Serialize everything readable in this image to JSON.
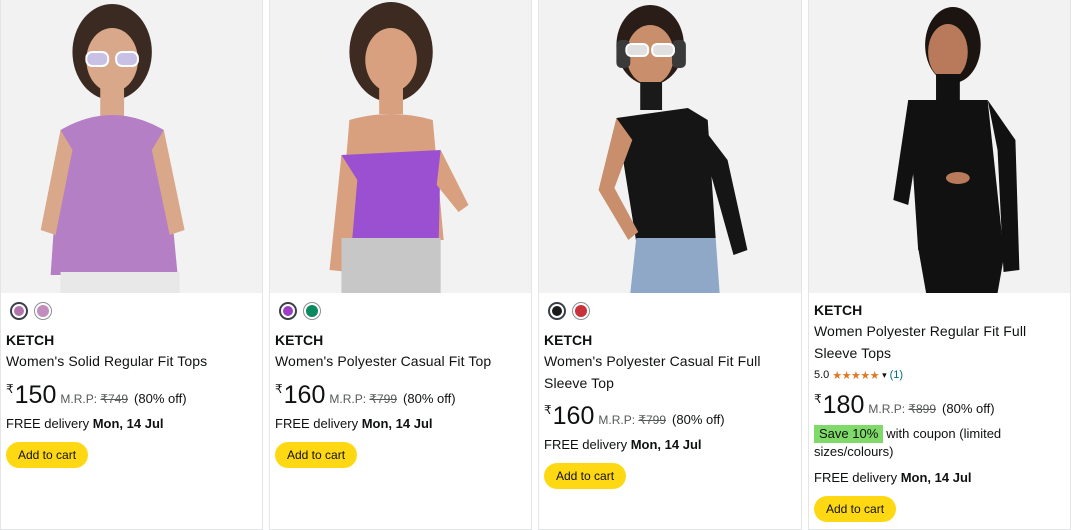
{
  "products": [
    {
      "swatches": [
        {
          "color": "#b274ae",
          "selected": true
        },
        {
          "color": "#c28cbf",
          "selected": false
        }
      ],
      "brand": "KETCH",
      "title": "Women's Solid Regular Fit Tops",
      "currency": "₹",
      "price": "150",
      "mrp_label": "M.R.P:",
      "mrp": "₹749",
      "discount": "(80% off)",
      "delivery_prefix": "FREE delivery",
      "delivery_date": "Mon, 14 Jul",
      "cart_label": "Add to cart"
    },
    {
      "swatches": [
        {
          "color": "#9b3fc4",
          "selected": true
        },
        {
          "color": "#0a8a5e",
          "selected": false
        }
      ],
      "brand": "KETCH",
      "title": "Women's Polyester Casual Fit Top",
      "currency": "₹",
      "price": "160",
      "mrp_label": "M.R.P:",
      "mrp": "₹799",
      "discount": "(80% off)",
      "delivery_prefix": "FREE delivery",
      "delivery_date": "Mon, 14 Jul",
      "cart_label": "Add to cart"
    },
    {
      "swatches": [
        {
          "color": "#1a1a1a",
          "selected": true
        },
        {
          "color": "#c8323a",
          "selected": false
        }
      ],
      "brand": "KETCH",
      "title_line1": "Women's Polyester Casual Fit Full",
      "title_line2": "Sleeve Top",
      "currency": "₹",
      "price": "160",
      "mrp_label": "M.R.P:",
      "mrp": "₹799",
      "discount": "(80% off)",
      "delivery_prefix": "FREE delivery",
      "delivery_date": "Mon, 14 Jul",
      "cart_label": "Add to cart"
    },
    {
      "brand": "KETCH",
      "title_line1": "Women Polyester Regular Fit Full",
      "title_line2": "Sleeve Tops",
      "rating": "5.0",
      "stars": "★★★★★",
      "rating_count": "(1)",
      "currency": "₹",
      "price": "180",
      "mrp_label": "M.R.P:",
      "mrp": "₹899",
      "discount": "(80% off)",
      "coupon_badge": "Save 10%",
      "coupon_text": "with coupon (limited sizes/colours)",
      "delivery_prefix": "FREE delivery",
      "delivery_date": "Mon, 14 Jul",
      "cart_label": "Add to cart"
    }
  ],
  "colors": {
    "cart_button": "#ffd814",
    "coupon_badge": "#7fda69",
    "star": "#de7921",
    "link": "#007185"
  }
}
